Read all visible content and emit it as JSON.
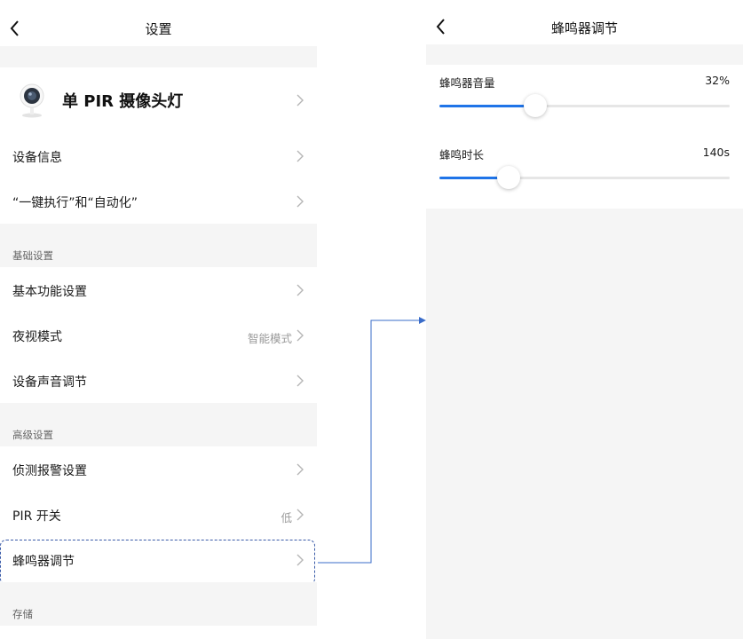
{
  "left_screen": {
    "header": {
      "title": "设置",
      "back_icon": "chevron-left-icon"
    },
    "device": {
      "name": "单 PIR 摄像头灯",
      "icon": "camera-icon"
    },
    "rows_top": [
      {
        "label": "设备信息"
      },
      {
        "label": "“一键执行”和“自动化”"
      }
    ],
    "section_basic": {
      "title": "基础设置",
      "rows": [
        {
          "label": "基本功能设置",
          "value": ""
        },
        {
          "label": "夜视模式",
          "value": "智能模式"
        },
        {
          "label": "设备声音调节",
          "value": ""
        }
      ]
    },
    "section_advanced": {
      "title": "高级设置",
      "rows": [
        {
          "label": "侦测报警设置",
          "value": ""
        },
        {
          "label": "PIR 开关",
          "value": "低"
        },
        {
          "label": "蜂鸣器调节",
          "value": ""
        }
      ]
    },
    "section_storage": {
      "title": "存储"
    }
  },
  "right_screen": {
    "header": {
      "title": "蜂鸣器调节",
      "back_icon": "chevron-left-icon"
    },
    "sliders": [
      {
        "label": "蜂鸣器音量",
        "value_text": "32%",
        "fraction": 0.33
      },
      {
        "label": "蜂鸣时长",
        "value_text": "140s",
        "fraction": 0.24
      }
    ]
  },
  "colors": {
    "accent": "#1f74e8",
    "annotation": "#3a5ba8",
    "background": "#f5f5f5"
  }
}
